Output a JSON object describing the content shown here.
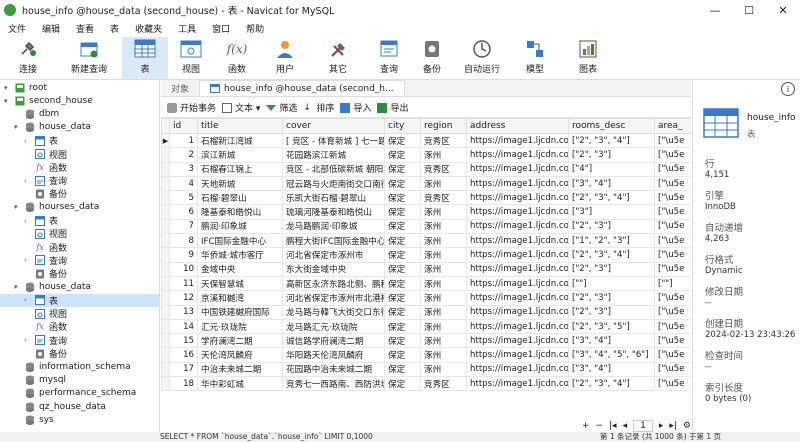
{
  "window": {
    "title": "house_info @house_data (second_house) - 表 - Navicat for MySQL"
  },
  "menu": [
    "文件",
    "编辑",
    "查看",
    "表",
    "收藏夹",
    "工具",
    "窗口",
    "帮助"
  ],
  "toolbar": [
    {
      "label": "连接",
      "icon": "plug-icon"
    },
    {
      "label": "新建查询",
      "icon": "new-query-icon"
    },
    {
      "label": "表",
      "icon": "table-icon",
      "active": true
    },
    {
      "label": "视图",
      "icon": "view-icon"
    },
    {
      "label": "函数",
      "icon": "function-icon",
      "glyph": "f(x)"
    },
    {
      "label": "用户",
      "icon": "user-icon"
    },
    {
      "label": "其它",
      "icon": "tools-icon"
    },
    {
      "label": "查询",
      "icon": "query-icon"
    },
    {
      "label": "备份",
      "icon": "backup-icon"
    },
    {
      "label": "自动运行",
      "icon": "autorun-icon"
    },
    {
      "label": "模型",
      "icon": "model-icon"
    },
    {
      "label": "图表",
      "icon": "chart-icon"
    }
  ],
  "sidebar": {
    "items": [
      {
        "label": "root",
        "level": 0,
        "icon": "server-icon",
        "expanded": true
      },
      {
        "label": "second_house",
        "level": 0,
        "icon": "server-icon",
        "expanded": true
      },
      {
        "label": "dbm",
        "level": 1,
        "icon": "database-icon"
      },
      {
        "label": "house_data",
        "level": 1,
        "icon": "database-icon",
        "expanded": true
      },
      {
        "label": "表",
        "level": 2,
        "icon": "table-icon",
        "collapsed": true
      },
      {
        "label": "视图",
        "level": 2,
        "icon": "view-icon"
      },
      {
        "label": "函数",
        "level": 2,
        "icon": "function-icon",
        "glyph": "fx"
      },
      {
        "label": "查询",
        "level": 2,
        "icon": "query-icon",
        "collapsed": true
      },
      {
        "label": "备份",
        "level": 2,
        "icon": "backup-icon"
      },
      {
        "label": "hourses_data",
        "level": 1,
        "icon": "database-icon",
        "expanded": true
      },
      {
        "label": "表",
        "level": 2,
        "icon": "table-icon",
        "collapsed": true
      },
      {
        "label": "视图",
        "level": 2,
        "icon": "view-icon"
      },
      {
        "label": "函数",
        "level": 2,
        "icon": "function-icon",
        "glyph": "fx"
      },
      {
        "label": "查询",
        "level": 2,
        "icon": "query-icon",
        "collapsed": true
      },
      {
        "label": "备份",
        "level": 2,
        "icon": "backup-icon"
      },
      {
        "label": "house_data",
        "level": 1,
        "icon": "database-icon",
        "expanded": true
      },
      {
        "label": "表",
        "level": 2,
        "icon": "table-icon",
        "collapsed": true,
        "selected": true
      },
      {
        "label": "视图",
        "level": 2,
        "icon": "view-icon"
      },
      {
        "label": "函数",
        "level": 2,
        "icon": "function-icon",
        "glyph": "fx"
      },
      {
        "label": "查询",
        "level": 2,
        "icon": "query-icon",
        "collapsed": true
      },
      {
        "label": "备份",
        "level": 2,
        "icon": "backup-icon"
      },
      {
        "label": "information_schema",
        "level": 1,
        "icon": "database-icon"
      },
      {
        "label": "mysql",
        "level": 1,
        "icon": "database-icon"
      },
      {
        "label": "performance_schema",
        "level": 1,
        "icon": "database-icon"
      },
      {
        "label": "qz_house_data",
        "level": 1,
        "icon": "database-icon"
      },
      {
        "label": "sys",
        "level": 1,
        "icon": "database-icon"
      }
    ]
  },
  "tabs": [
    {
      "label": "对象",
      "active": false
    },
    {
      "label": "house_info @house_data (second_h...",
      "active": true,
      "icon": "table-icon"
    }
  ],
  "subtoolbar": [
    {
      "label": "开始事务",
      "icon": "transaction-icon"
    },
    {
      "label": "文本 ▾",
      "icon": "text-icon"
    },
    {
      "label": "筛选",
      "icon": "filter-icon"
    },
    {
      "label": "排序",
      "icon": "sort-icon"
    },
    {
      "label": "导入",
      "icon": "import-icon"
    },
    {
      "label": "导出",
      "icon": "export-icon"
    }
  ],
  "grid": {
    "columns": [
      "id",
      "title",
      "cover",
      "city",
      "region",
      "address",
      "rooms_desc",
      "area_"
    ],
    "rows": [
      [
        "1",
        "石榴新江湾城",
        "[ 竞区 - 体育新城 ] 七一路与",
        "保定",
        "竞秀区",
        "https://image1.ljcdn.com/",
        "[\"2\", \"3\", \"4\"]",
        "[\"\\u5e"
      ],
      [
        "2",
        "滨江新城",
        "花园路滨江新城",
        "保定",
        "涿州",
        "https://image1.ljcdn.com/",
        "[\"2\", \"3\"]",
        "[\"\\u5e"
      ],
      [
        "3",
        "石榴春江锦上",
        "竞区 - 北部低碳新城 朝阳大",
        "保定",
        "竞秀区",
        "https://image1.ljcdn.com/",
        "[\"4\"]",
        "[\"\\u5e"
      ],
      [
        "4",
        "天地新城",
        "冠云路与火炬南街交口南行",
        "保定",
        "涿州",
        "https://image1.ljcdn.com/",
        "[\"3\", \"4\"]",
        "[\"\\u5e"
      ],
      [
        "5",
        "石榴·碧翠山",
        "乐凯大街石榴·碧翠山",
        "保定",
        "竞秀区",
        "https://image1.ljcdn.com/",
        "[\"2\", \"3\", \"4\"]",
        "[\"\\u5e"
      ],
      [
        "6",
        "隆基泰和皓悦山",
        "琉璃河隆基泰和皓悦山",
        "保定",
        "涿州",
        "https://image1.ljcdn.com/",
        "[\"3\"]",
        "[\"\\u5e"
      ],
      [
        "7",
        "鹏润·印象城",
        "龙马路鹏润·印象城",
        "保定",
        "涿州",
        "https://image1.ljcdn.com/",
        "[\"2\", \"3\"]",
        "[\"\\u5e"
      ],
      [
        "8",
        "IFC国际金融中心",
        "鹏程大街IFC国际金融中心",
        "保定",
        "涿州",
        "https://image1.ljcdn.com/",
        "[\"1\", \"2\", \"3\"]",
        "[\"\\u5e"
      ],
      [
        "9",
        "华侨城·城市客厅",
        "河北省保定市涿州市",
        "保定",
        "涿州",
        "https://image1.ljcdn.com/",
        "[\"2\", \"3\", \"4\"]",
        "[\"\\u5e"
      ],
      [
        "10",
        "金域中央",
        "东大街金域中央",
        "保定",
        "涿州",
        "https://image1.ljcdn.com/",
        "[\"2\", \"3\"]",
        "[\"\\u5e"
      ],
      [
        "11",
        "天保智慧城",
        "高新区永济东路北侧、鹏程大",
        "保定",
        "涿州",
        "https://image1.ljcdn.com/",
        "[\"\"]",
        "[\"\"]"
      ],
      [
        "12",
        "京溪和樾湾",
        "河北省保定市涿州市北港村",
        "保定",
        "涿州",
        "https://image1.ljcdn.com/",
        "[\"2\", \"3\"]",
        "[\"\\u5e"
      ],
      [
        "13",
        "中国铁建樾府国际",
        "龙马路与韓飞大街交口东行",
        "保定",
        "涿州",
        "https://image1.ljcdn.com/",
        "[\"2\", \"3\"]",
        "[\"\\u5e"
      ],
      [
        "14",
        "汇元·玖珑院",
        "龙马路汇元·玖珑院",
        "保定",
        "涿州",
        "https://image1.ljcdn.com/",
        "[\"2\", \"3\", \"5\"]",
        "[\"\\u5e"
      ],
      [
        "15",
        "学府澜湾二期",
        "诚信路学府澜湾二期",
        "保定",
        "涿州",
        "https://image1.ljcdn.com/",
        "[\"3\", \"4\"]",
        "[\"\\u5e"
      ],
      [
        "16",
        "天伦湾凤麟府",
        "华阳路天伦湾凤麟府",
        "保定",
        "涿州",
        "https://image1.ljcdn.com/",
        "[\"3\", \"4\", \"5\", \"6\"]",
        "[\"\\u5e"
      ],
      [
        "17",
        "中治未来城二期",
        "花园路中治未来城二期",
        "保定",
        "涿州",
        "https://image1.ljcdn.com/",
        "[\"3\", \"4\"]",
        "[\"\\u5e"
      ],
      [
        "18",
        "华中彩虹城",
        "竞秀七一西路南、西防洪堤东",
        "保定",
        "竞秀区",
        "https://image1.ljcdn.com/",
        "[\"2\", \"3\", \"4\"]",
        "[\"\\u5e"
      ]
    ]
  },
  "pager": {
    "first": "|◂",
    "prev": "◂",
    "page": "1",
    "next": "▸",
    "last": "▸|",
    "settings": "⚙"
  },
  "statusbar": {
    "sql": "SELECT * FROM `house_data`.`house_info` LIMIT 0,1000",
    "record": "第 1 条记录 (共 1000 条) 于第 1 页"
  },
  "info": {
    "table_name": "house_info",
    "table_type": "表",
    "fields": [
      {
        "label": "行",
        "value": "4,151"
      },
      {
        "label": "引擎",
        "value": "InnoDB"
      },
      {
        "label": "自动递增",
        "value": "4,263"
      },
      {
        "label": "行格式",
        "value": "Dynamic"
      },
      {
        "label": "修改日期",
        "value": "--"
      },
      {
        "label": "创建日期",
        "value": "2024-02-13 23:43:26"
      },
      {
        "label": "检查时间",
        "value": "--"
      },
      {
        "label": "索引长度",
        "value": "0 bytes (0)"
      }
    ]
  },
  "colors": {
    "accent": "#2f6fb3",
    "selection": "#cfe3f7",
    "toolbar_active": "#dbe8f5"
  }
}
